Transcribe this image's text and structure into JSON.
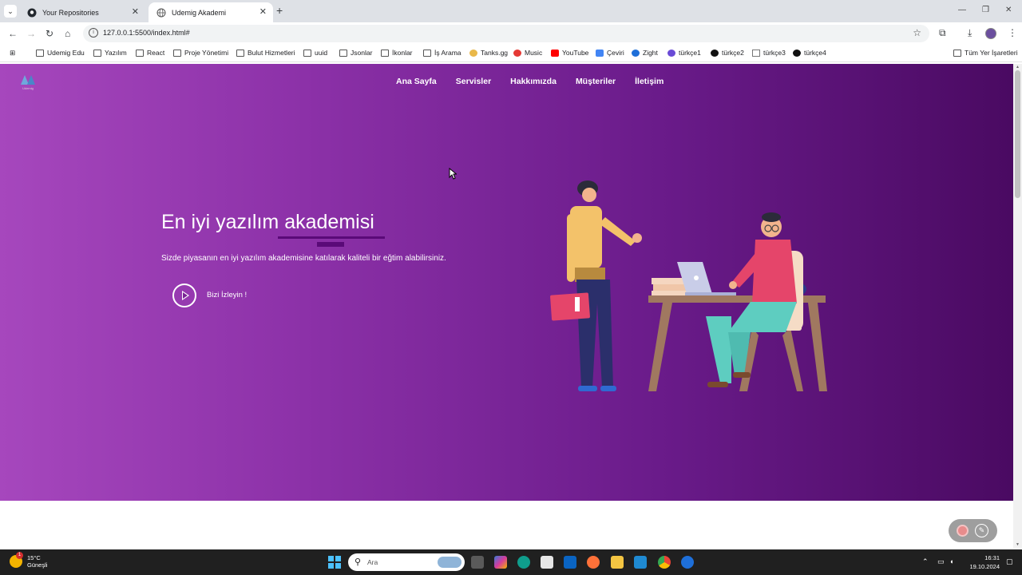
{
  "browser": {
    "tabs": [
      {
        "title": "Your Repositories",
        "active": false
      },
      {
        "title": "Udemig Akademi",
        "active": true
      }
    ],
    "url": "127.0.0.1:5500/index.html#",
    "bookmarks": [
      {
        "label": "Udemig Edu",
        "icon": "folder-icon"
      },
      {
        "label": "Yazılım",
        "icon": "folder-icon"
      },
      {
        "label": "React",
        "icon": "folder-icon"
      },
      {
        "label": "Proje Yönetimi",
        "icon": "folder-icon"
      },
      {
        "label": "Bulut Hizmetleri",
        "icon": "folder-icon"
      },
      {
        "label": "uuid",
        "icon": "folder-icon"
      },
      {
        "label": "Jsonlar",
        "icon": "folder-icon"
      },
      {
        "label": "İkonlar",
        "icon": "folder-icon"
      },
      {
        "label": "İş Arama",
        "icon": "folder-icon"
      },
      {
        "label": "Tanks.gg",
        "icon": "tanks-icon"
      },
      {
        "label": "Music",
        "icon": "music-icon"
      },
      {
        "label": "YouTube",
        "icon": "youtube-icon"
      },
      {
        "label": "Çeviri",
        "icon": "translate-icon"
      },
      {
        "label": "Zight",
        "icon": "zight-icon"
      },
      {
        "label": "türkçe1",
        "icon": "chatbot-icon"
      },
      {
        "label": "türkçe2",
        "icon": "chatgpt-icon"
      },
      {
        "label": "türkçe3",
        "icon": "doc-icon"
      },
      {
        "label": "türkçe4",
        "icon": "chatgpt-icon"
      }
    ],
    "all_bookmarks": "Tüm Yer İşaretleri"
  },
  "site": {
    "logo_text": "Udemig",
    "nav": [
      "Ana Sayfa",
      "Servisler",
      "Hakkımızda",
      "Müşteriler",
      "İletişim"
    ],
    "hero": {
      "title": "En iyi yazılım akademisi",
      "description": "Sizde piyasanın en iyi yazılım akademisine katılarak kaliteli bir eğtim alabilirsiniz.",
      "cta": "Bizi İzleyin !"
    }
  },
  "taskbar": {
    "weather_temp": "15°C",
    "weather_desc": "Güneşli",
    "weather_badge": "1",
    "search_placeholder": "Ara",
    "time": "16:31",
    "date": "19.10.2024"
  },
  "colors": {
    "hero_start": "#a647bd",
    "hero_end": "#4a0a62",
    "accent": "#5a0a78"
  }
}
